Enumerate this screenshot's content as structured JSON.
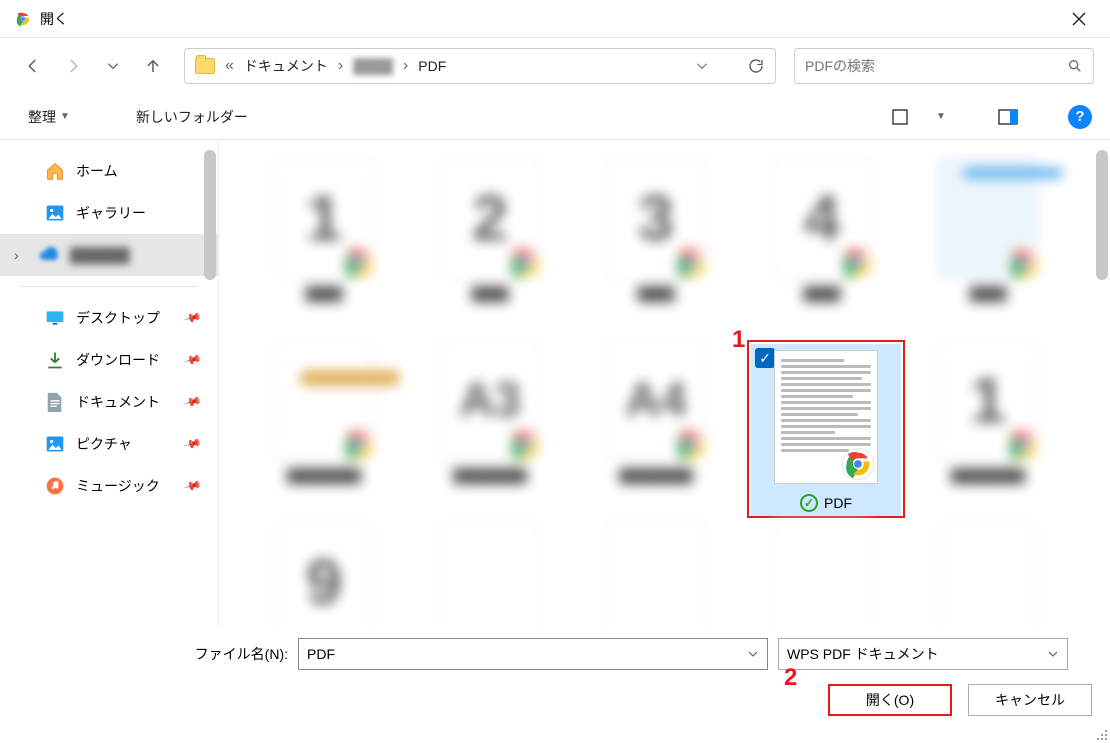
{
  "dialog": {
    "title": "開く"
  },
  "breadcrumb": {
    "levels": [
      "ドキュメント",
      "",
      "PDF"
    ],
    "ellipsis": "«"
  },
  "search": {
    "placeholder": "PDFの検索"
  },
  "toolbar": {
    "organize": "整理",
    "newfolder": "新しいフォルダー"
  },
  "sidebar": {
    "home": "ホーム",
    "gallery": "ギャラリー",
    "desktop": "デスクトップ",
    "downloads": "ダウンロード",
    "documents": "ドキュメント",
    "pictures": "ピクチャ",
    "music": "ミュージック"
  },
  "file": {
    "selected_label": "PDF"
  },
  "footer": {
    "filename_label": "ファイル名(N):",
    "filename_value": "PDF",
    "filetype_value": "WPS PDF ドキュメント",
    "open": "開く(O)",
    "cancel": "キャンセル"
  },
  "callouts": {
    "one": "1",
    "two": "2"
  }
}
